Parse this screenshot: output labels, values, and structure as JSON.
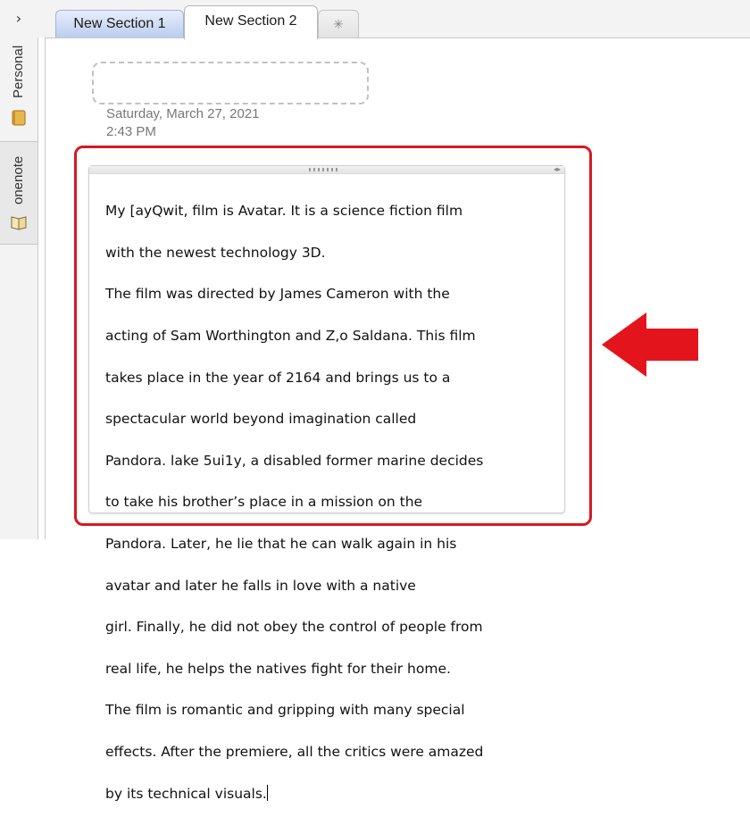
{
  "sidebar": {
    "collapse_label": "›",
    "notebooks": [
      {
        "label": "Personal",
        "icon": "notebook-icon"
      },
      {
        "label": "onenote",
        "icon": "open-book-icon"
      }
    ]
  },
  "tabs": {
    "section1": "New Section 1",
    "section2": "New Section 2",
    "add_label": "✳"
  },
  "page": {
    "title_placeholder": "",
    "date": "Saturday, March 27, 2021",
    "time": "2:43 PM"
  },
  "note": {
    "lines": [
      "My [ayQwit, film is Avatar. It is a science fiction film",
      "with the newest technology 3D.",
      "The film was directed by James Cameron with the",
      "acting of Sam Worthington and Z,o Saldana. This film",
      "takes place in the year of 2164 and brings us to a",
      "spectacular world beyond imagination called",
      "Pandora. lake 5ui1y, a disabled former marine decides",
      "to take his brother’s place in a mission on the",
      "Pandora. Later, he lie that he can walk again in his",
      "avatar and later he falls in love with a native",
      "girl. Finally, he did not obey the control of people from",
      "real life, he helps the natives fight for their home.",
      "The film is romantic and gripping with many special",
      "effects. After the premiere, all the critics were amazed",
      "by its technical visuals."
    ]
  },
  "colors": {
    "highlight": "#d71920",
    "arrow": "#e4141c",
    "active_tab": "#ffffff",
    "inactive_tab": "#bccdee"
  }
}
